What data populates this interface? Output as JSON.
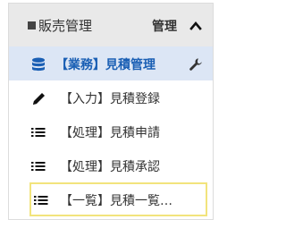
{
  "header": {
    "title": "販売管理",
    "right_label": "管理",
    "chevron_icon": "chevron-up-icon"
  },
  "menu": {
    "items": [
      {
        "label": "【業務】見積管理",
        "icon": "database-icon",
        "trailing_icon": "wrench-icon",
        "state": "active"
      },
      {
        "label": "【入力】見積登録",
        "icon": "pencil-icon"
      },
      {
        "label": "【処理】見積申請",
        "icon": "list-icon"
      },
      {
        "label": "【処理】見積承認",
        "icon": "list-icon"
      },
      {
        "label": "【一覧】見積一覧…",
        "icon": "list-icon",
        "state": "selected"
      }
    ]
  },
  "colors": {
    "header_bg": "#e9e9e9",
    "active_bg": "#dce6f5",
    "active_text": "#1a5fb4",
    "selected_border": "#f2e47c"
  }
}
